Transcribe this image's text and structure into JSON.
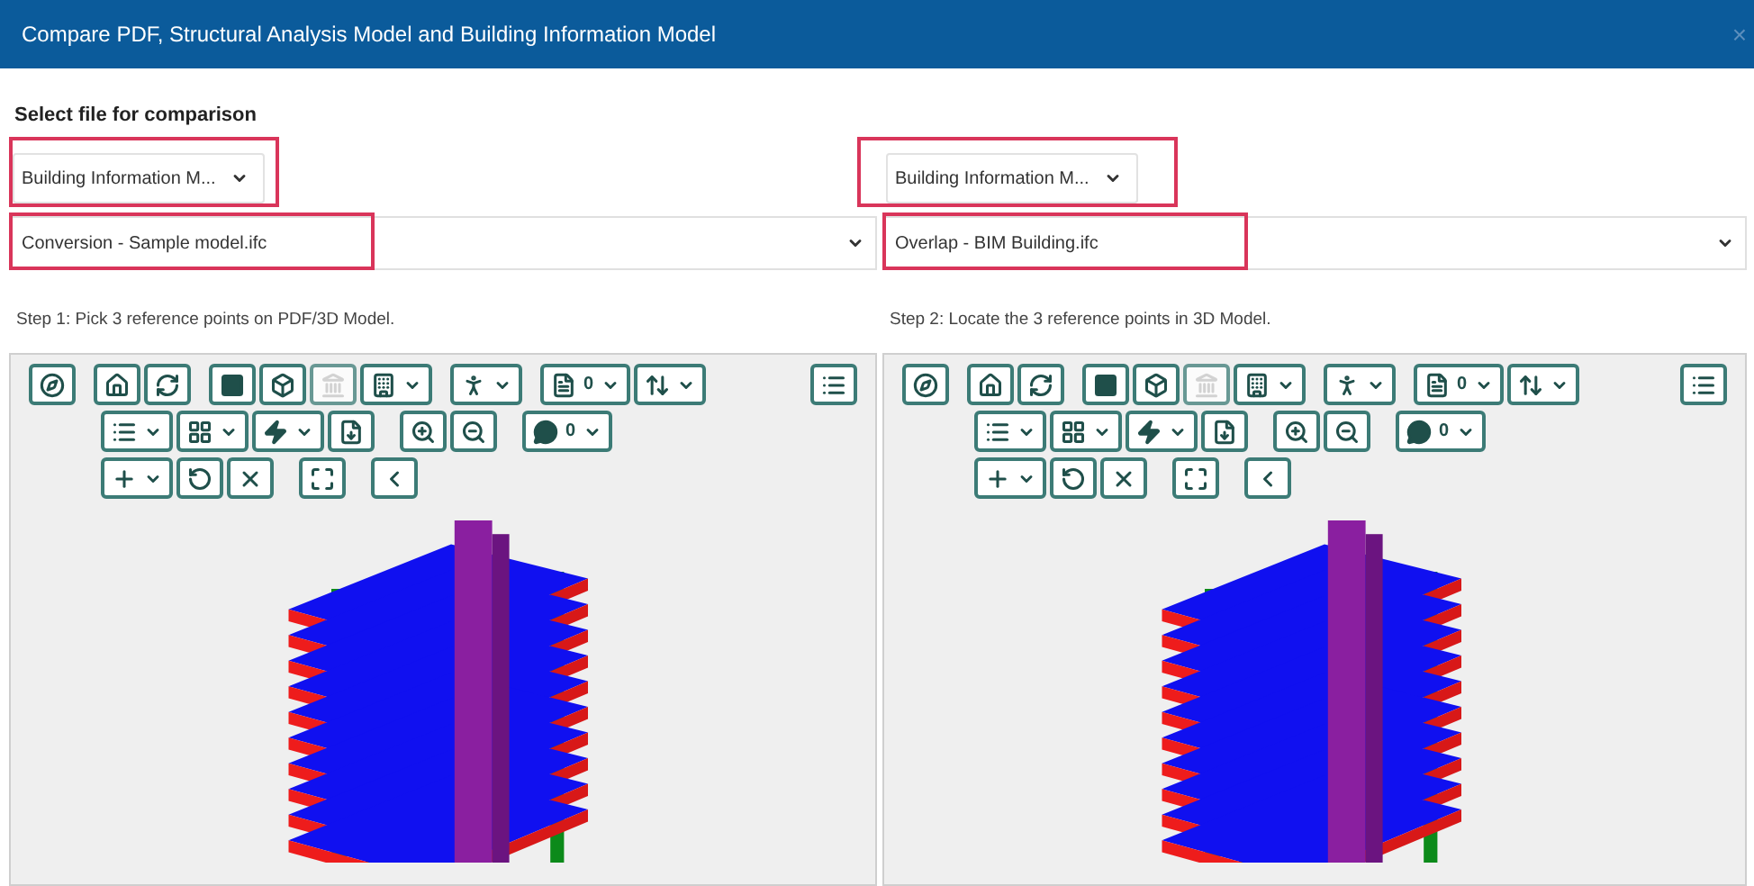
{
  "window": {
    "title": "Compare PDF, Structural Analysis Model and Building Information Model",
    "close": "×"
  },
  "section_label": "Select file for comparison",
  "panels": [
    {
      "type_select": {
        "value": "Building Information M...",
        "highlighted": true
      },
      "file_select": {
        "value": "Conversion - Sample model.ifc",
        "highlighted": true
      },
      "step": "Step 1: Pick 3 reference points on PDF/3D Model.",
      "toolbar": {
        "pdf_count": "0",
        "comment_count": "0",
        "bank_disabled": true
      }
    },
    {
      "type_select": {
        "value": "Building Information M...",
        "highlighted": true
      },
      "file_select": {
        "value": "Overlap - BIM Building.ifc",
        "highlighted": true
      },
      "step": "Step 2: Locate the 3 reference points in 3D Model.",
      "toolbar": {
        "pdf_count": "0",
        "comment_count": "0",
        "bank_disabled": true
      }
    }
  ]
}
